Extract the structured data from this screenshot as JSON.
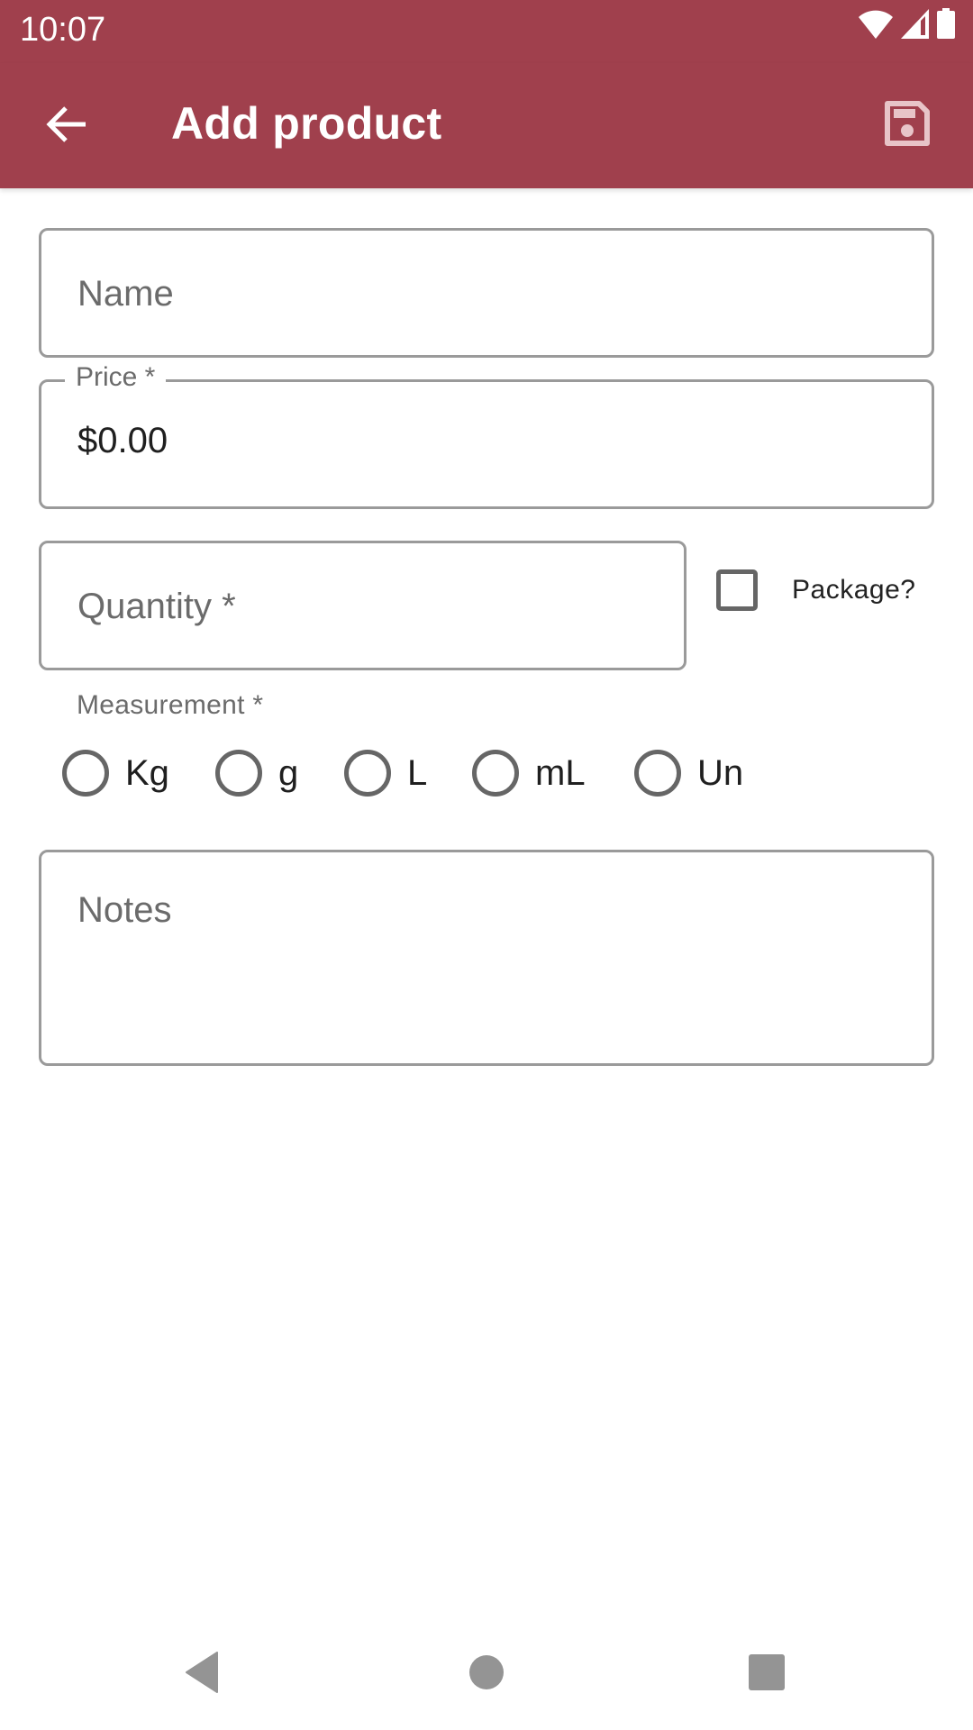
{
  "status_bar": {
    "time": "10:07",
    "icons": [
      "wifi-icon",
      "signal-icon",
      "battery-icon"
    ]
  },
  "toolbar": {
    "title": "Add product",
    "back_icon": "arrow-back-icon",
    "save_icon": "save-icon",
    "background_color": "#A0404D"
  },
  "form": {
    "name": {
      "placeholder": "Name",
      "value": ""
    },
    "price": {
      "label": "Price *",
      "value": "$0.00"
    },
    "quantity": {
      "placeholder": "Quantity *",
      "value": ""
    },
    "package": {
      "label": "Package?",
      "checked": false
    },
    "measurement": {
      "label": "Measurement *",
      "options": [
        "Kg",
        "g",
        "L",
        "mL",
        "Un"
      ],
      "selected": null
    },
    "notes": {
      "placeholder": "Notes",
      "value": ""
    }
  },
  "nav_bar": {
    "buttons": [
      "back-nav",
      "home-nav",
      "recents-nav"
    ]
  }
}
